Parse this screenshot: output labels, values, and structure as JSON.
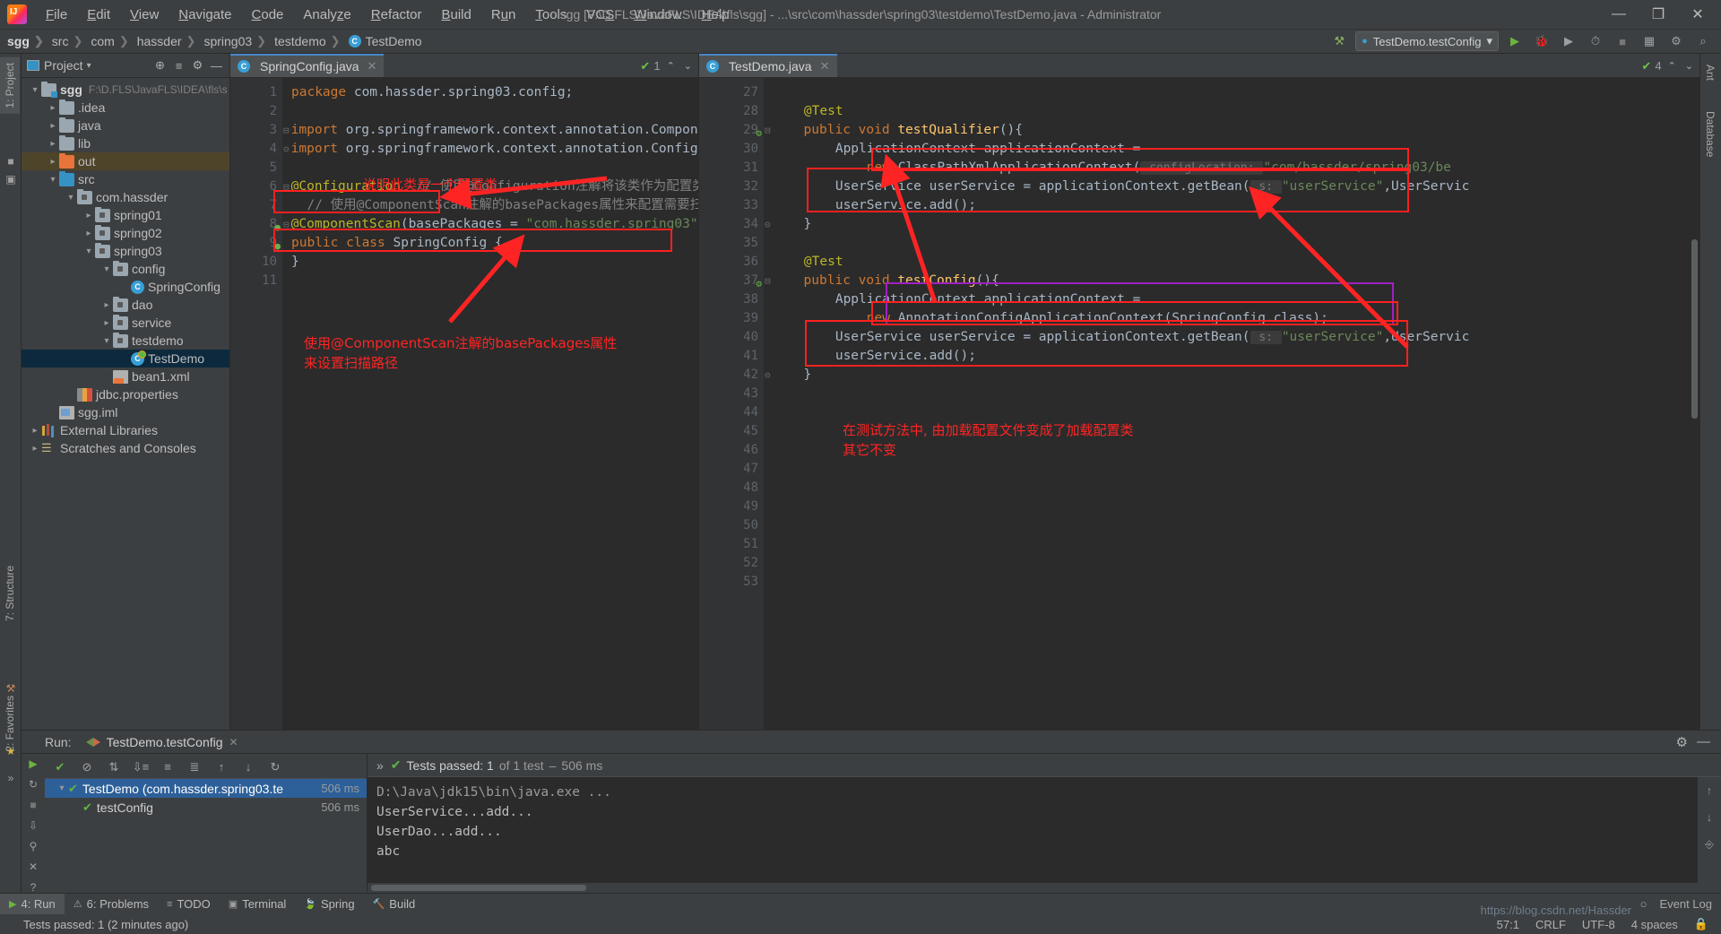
{
  "window": {
    "title": "sgg [F:\\D.FLS\\JavaFLS\\IDEA\\fls\\sgg] - ...\\src\\com\\hassder\\spring03\\testdemo\\TestDemo.java - Administrator",
    "minimize": "—",
    "maximize": "❐",
    "close": "✕"
  },
  "menu": [
    "File",
    "Edit",
    "View",
    "Navigate",
    "Code",
    "Analyze",
    "Refactor",
    "Build",
    "Run",
    "Tools",
    "VCS",
    "Window",
    "Help"
  ],
  "breadcrumb": [
    "sgg",
    "src",
    "com",
    "hassder",
    "spring03",
    "testdemo",
    "TestDemo"
  ],
  "navbar": {
    "hammer": "⚒",
    "run_config": "TestDemo.testConfig",
    "chevron": "▾",
    "run": "▶",
    "debug": "🐞",
    "coverage": "▶",
    "profile": "⏱",
    "stop": "■",
    "layout": "▦",
    "search": "⌕"
  },
  "project": {
    "title": "Project",
    "chevron": "▾",
    "locate_icon": "⊕",
    "collapse_icon": "≡",
    "settings_icon": "⚙",
    "hide_icon": "—",
    "tree": [
      {
        "depth": 0,
        "arrow": "v",
        "icon": "folder-module",
        "label": "sgg",
        "bold": true,
        "path": "F:\\D.FLS\\JavaFLS\\IDEA\\fls\\s",
        "state": "normal"
      },
      {
        "depth": 1,
        "arrow": ">",
        "icon": "folder",
        "label": ".idea",
        "state": "normal"
      },
      {
        "depth": 1,
        "arrow": ">",
        "icon": "folder",
        "label": "java",
        "state": "normal"
      },
      {
        "depth": 1,
        "arrow": ">",
        "icon": "folder",
        "label": "lib",
        "state": "normal"
      },
      {
        "depth": 1,
        "arrow": ">",
        "icon": "folder-orange",
        "label": "out",
        "state": "out"
      },
      {
        "depth": 1,
        "arrow": "v",
        "icon": "folder-blue",
        "label": "src",
        "state": "normal"
      },
      {
        "depth": 2,
        "arrow": "v",
        "icon": "package",
        "label": "com.hassder",
        "state": "normal"
      },
      {
        "depth": 3,
        "arrow": ">",
        "icon": "package",
        "label": "spring01",
        "state": "normal"
      },
      {
        "depth": 3,
        "arrow": ">",
        "icon": "package",
        "label": "spring02",
        "state": "normal"
      },
      {
        "depth": 3,
        "arrow": "v",
        "icon": "package",
        "label": "spring03",
        "state": "normal"
      },
      {
        "depth": 4,
        "arrow": "v",
        "icon": "package",
        "label": "config",
        "state": "normal"
      },
      {
        "depth": 5,
        "arrow": "",
        "icon": "class",
        "label": "SpringConfig",
        "state": "normal"
      },
      {
        "depth": 4,
        "arrow": ">",
        "icon": "package",
        "label": "dao",
        "state": "normal"
      },
      {
        "depth": 4,
        "arrow": ">",
        "icon": "package",
        "label": "service",
        "state": "normal"
      },
      {
        "depth": 4,
        "arrow": "v",
        "icon": "package",
        "label": "testdemo",
        "state": "normal"
      },
      {
        "depth": 5,
        "arrow": "",
        "icon": "test-class",
        "label": "TestDemo",
        "state": "selected"
      },
      {
        "depth": 4,
        "arrow": "",
        "icon": "xml",
        "label": "bean1.xml",
        "state": "normal"
      },
      {
        "depth": 2,
        "arrow": "",
        "icon": "properties",
        "label": "jdbc.properties",
        "state": "normal"
      },
      {
        "depth": 1,
        "arrow": "",
        "icon": "iml",
        "label": "sgg.iml",
        "state": "normal"
      },
      {
        "depth": 0,
        "arrow": ">",
        "icon": "library",
        "label": "External Libraries",
        "state": "normal"
      },
      {
        "depth": 0,
        "arrow": ">",
        "icon": "scratch",
        "label": "Scratches and Consoles",
        "state": "normal"
      }
    ]
  },
  "left_strip": [
    {
      "label": "1: Project",
      "selected": true
    },
    {
      "label": "7: Structure",
      "selected": false
    },
    {
      "label": "2: Favorites",
      "selected": false
    }
  ],
  "right_strip": [
    {
      "label": "Ant",
      "selected": false
    },
    {
      "label": "Database",
      "selected": false
    }
  ],
  "editor_left": {
    "tab": {
      "label": "SpringConfig.java",
      "close": "✕",
      "icon": "class-icon"
    },
    "inspection": {
      "count": "1",
      "status_icon": "✔",
      "up": "⌃",
      "down": "⌄"
    },
    "first_line": 1,
    "lines": [
      {
        "n": 1,
        "tokens": [
          {
            "t": "package ",
            "c": "kw"
          },
          {
            "t": "com.hassder.spring03.config;",
            "c": "id"
          }
        ]
      },
      {
        "n": 2,
        "tokens": []
      },
      {
        "n": 3,
        "fold": "⊟",
        "tokens": [
          {
            "t": "import ",
            "c": "kw"
          },
          {
            "t": "org.springframework.context.annotation.Component",
            "c": "id"
          },
          {
            "t": "S",
            "c": "id"
          }
        ]
      },
      {
        "n": 4,
        "fold": "⊝",
        "tokens": [
          {
            "t": "import ",
            "c": "kw"
          },
          {
            "t": "org.springframework.context.annotation.Configura",
            "c": "id"
          },
          {
            "t": "t",
            "c": "id"
          }
        ]
      },
      {
        "n": 5,
        "tokens": []
      },
      {
        "n": 6,
        "fold": "⊟",
        "tokens": [
          {
            "t": "@Configuration",
            "c": "ann"
          },
          {
            "t": "  // 使用@Configuration注解将该类作为配置类,代表",
            "c": "cmt"
          }
        ]
      },
      {
        "n": 7,
        "tokens": [
          {
            "t": "  // 使用@ComponentScan注解的basePackages属性来配置需要扫描的包路",
            "c": "cmt"
          }
        ]
      },
      {
        "n": 8,
        "mark": "bean",
        "fold": "⊟",
        "tokens": [
          {
            "t": "@ComponentScan",
            "c": "ann"
          },
          {
            "t": "(basePackages = ",
            "c": "id"
          },
          {
            "t": "\"com.hassder.spring03\")",
            "c": "str"
          }
        ]
      },
      {
        "n": 9,
        "mark": "bean2",
        "tokens": [
          {
            "t": "public class ",
            "c": "kw"
          },
          {
            "t": "SpringConfig ",
            "c": "id"
          },
          {
            "t": "{",
            "c": "id"
          }
        ]
      },
      {
        "n": 10,
        "tokens": [
          {
            "t": "}",
            "c": "id"
          }
        ]
      },
      {
        "n": 11,
        "tokens": []
      }
    ]
  },
  "editor_right": {
    "tab": {
      "label": "TestDemo.java",
      "close": "✕",
      "icon": "class-icon"
    },
    "inspection": {
      "count": "4",
      "status_icon": "✔",
      "up": "⌃",
      "down": "⌄"
    },
    "lines": [
      {
        "n": 27,
        "tokens": []
      },
      {
        "n": 28,
        "tokens": [
          {
            "t": "    @Test",
            "c": "ann"
          }
        ]
      },
      {
        "n": 29,
        "mark": "run",
        "fold": "⊟",
        "tokens": [
          {
            "t": "    public void ",
            "c": "kw"
          },
          {
            "t": "testQualifier",
            "c": "mth"
          },
          {
            "t": "(){",
            "c": "id"
          }
        ]
      },
      {
        "n": 30,
        "tokens": [
          {
            "t": "        ApplicationContext applicationContext =",
            "c": "id"
          }
        ]
      },
      {
        "n": 31,
        "tokens": [
          {
            "t": "            ",
            "c": "id"
          },
          {
            "t": "new ",
            "c": "kw"
          },
          {
            "t": "ClassPathXmlApplicationContext(",
            "c": "id"
          },
          {
            "t": " configLocation: ",
            "c": "hint"
          },
          {
            "t": "\"com/hassder/spring03/be",
            "c": "str"
          }
        ]
      },
      {
        "n": 32,
        "tokens": [
          {
            "t": "        UserService userService = applicationContext.getBean(",
            "c": "id"
          },
          {
            "t": " s: ",
            "c": "hint"
          },
          {
            "t": "\"userService\"",
            "c": "str"
          },
          {
            "t": ",UserServic",
            "c": "id"
          }
        ]
      },
      {
        "n": 33,
        "tokens": [
          {
            "t": "        userService.add();",
            "c": "id"
          }
        ]
      },
      {
        "n": 34,
        "fold": "⊝",
        "tokens": [
          {
            "t": "    }",
            "c": "id"
          }
        ]
      },
      {
        "n": 35,
        "tokens": []
      },
      {
        "n": 36,
        "tokens": [
          {
            "t": "    @Test",
            "c": "ann"
          }
        ]
      },
      {
        "n": 37,
        "mark": "run",
        "fold": "⊟",
        "tokens": [
          {
            "t": "    public void ",
            "c": "kw"
          },
          {
            "t": "testConfig",
            "c": "mth"
          },
          {
            "t": "(){",
            "c": "id"
          }
        ]
      },
      {
        "n": 38,
        "tokens": [
          {
            "t": "        ApplicationContext applicationContext =",
            "c": "id"
          }
        ]
      },
      {
        "n": 39,
        "tokens": [
          {
            "t": "            ",
            "c": "id"
          },
          {
            "t": "new ",
            "c": "kw"
          },
          {
            "t": "AnnotationConfigApplicationContext(SpringConfig.class);",
            "c": "id"
          }
        ]
      },
      {
        "n": 40,
        "tokens": [
          {
            "t": "        UserService userService = applicationContext.getBean(",
            "c": "id"
          },
          {
            "t": " s: ",
            "c": "hint"
          },
          {
            "t": "\"userService\"",
            "c": "str"
          },
          {
            "t": ",UserServic",
            "c": "id"
          }
        ]
      },
      {
        "n": 41,
        "tokens": [
          {
            "t": "        userService.add();",
            "c": "id"
          }
        ]
      },
      {
        "n": 42,
        "fold": "⊝",
        "tokens": [
          {
            "t": "    }",
            "c": "id"
          }
        ]
      },
      {
        "n": 43,
        "tokens": []
      },
      {
        "n": 44,
        "tokens": []
      },
      {
        "n": 45,
        "tokens": []
      },
      {
        "n": 46,
        "tokens": []
      },
      {
        "n": 47,
        "tokens": []
      },
      {
        "n": 48,
        "tokens": []
      },
      {
        "n": 49,
        "tokens": []
      },
      {
        "n": 50,
        "tokens": []
      },
      {
        "n": 51,
        "tokens": []
      },
      {
        "n": 52,
        "tokens": []
      },
      {
        "n": 53,
        "tokens": []
      }
    ]
  },
  "annotations": {
    "note1": "说明此类是一个配置类",
    "note2_line1": "使用@ComponentScan注解的basePackages属性",
    "note2_line2": "来设置扫描路径",
    "note3_line1": "在测试方法中, 由加载配置文件变成了加载配置类",
    "note3_line2": "其它不变",
    "color_red": "#ff2424",
    "color_purple": "#a020c0"
  },
  "run_panel": {
    "label": "Run:",
    "tab": "TestDemo.testConfig",
    "tab_close": "✕",
    "settings_icon": "⚙",
    "hide_icon": "—",
    "toolbar_icons": [
      "▶",
      "↻",
      "✕",
      "↓",
      "⌘",
      "⌗",
      "■"
    ],
    "test_toolbar_icons": [
      "✔",
      "⊘",
      "↓↑",
      "↓≡",
      "≡",
      "≡≡",
      "↑",
      "↓",
      "↻"
    ],
    "results_summary": {
      "icon": "✔",
      "text": "Tests passed: 1",
      "suffix": "of 1 test",
      "time": "506 ms",
      "expand": "»"
    },
    "tree": [
      {
        "depth": 0,
        "label": "TestDemo (com.hassder.spring03.te",
        "time": "506 ms",
        "selected": true
      },
      {
        "depth": 1,
        "label": "testConfig",
        "time": "506 ms",
        "selected": false
      }
    ],
    "console": [
      {
        "text": "D:\\Java\\jdk15\\bin\\java.exe ...",
        "dim": true
      },
      {
        "text": "UserService...add...",
        "dim": false
      },
      {
        "text": "UserDao...add...",
        "dim": false
      },
      {
        "text": "abc",
        "dim": false
      }
    ],
    "console_side_icons": [
      "↑",
      "↓",
      "⚑"
    ]
  },
  "bottom_bar": {
    "items": [
      {
        "icon": "▶",
        "label": "4: Run",
        "selected": true
      },
      {
        "icon": "⚠",
        "label": "6: Problems",
        "selected": false
      },
      {
        "icon": "≡",
        "label": "TODO",
        "selected": false
      },
      {
        "icon": "▣",
        "label": "Terminal",
        "selected": false
      },
      {
        "icon": "🍃",
        "label": "Spring",
        "selected": false
      },
      {
        "icon": "🔨",
        "label": "Build",
        "selected": false
      }
    ],
    "event_log": {
      "icon": "○",
      "label": "Event Log"
    }
  },
  "status_bar": {
    "message": "Tests passed: 1 (2 minutes ago)",
    "caret": "57:1",
    "line_sep": "CRLF",
    "encoding": "UTF-8",
    "indent": "4 spaces",
    "lock_icon": "🔒"
  },
  "watermark": "https://blog.csdn.net/Hassder"
}
